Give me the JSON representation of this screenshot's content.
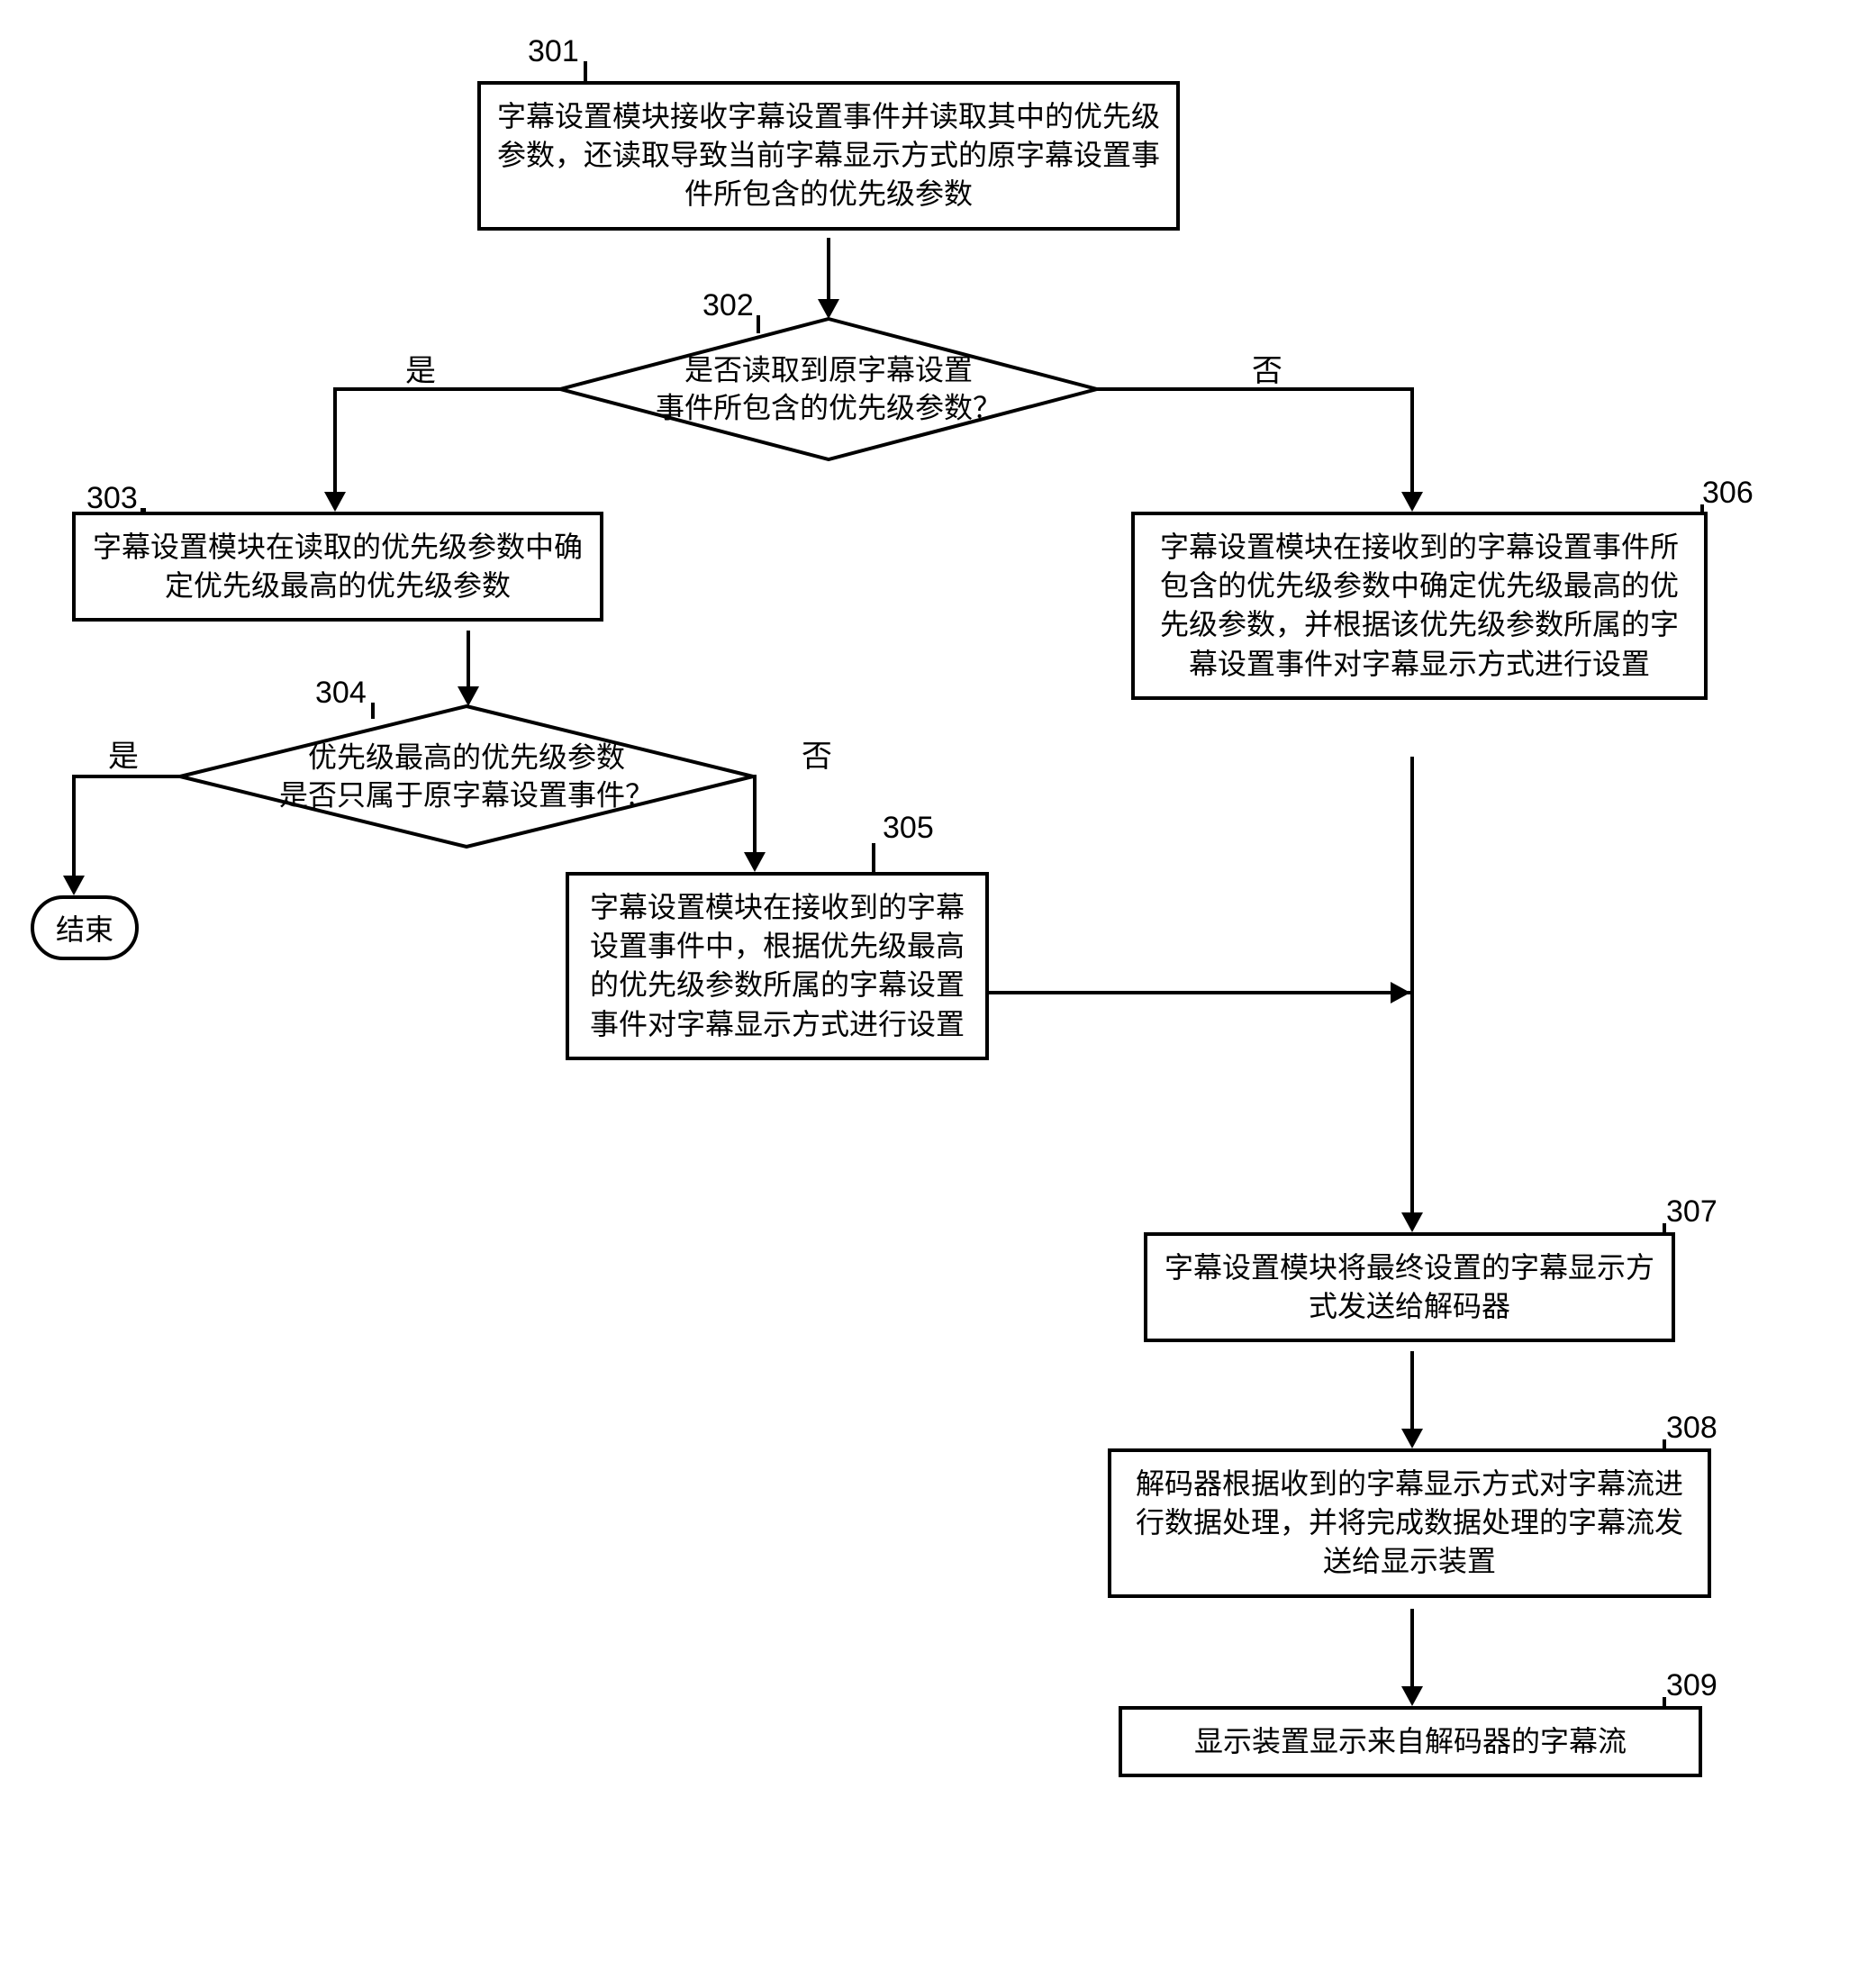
{
  "steps": {
    "s301": {
      "num": "301",
      "text": "字幕设置模块接收字幕设置事件并读取其中的优先级参数，还读取导致当前字幕显示方式的原字幕设置事件所包含的优先级参数"
    },
    "s302": {
      "num": "302",
      "text": "是否读取到原字幕设置事件所包含的优先级参数？"
    },
    "s303": {
      "num": "303",
      "text": "字幕设置模块在读取的优先级参数中确定优先级最高的优先级参数"
    },
    "s304": {
      "num": "304",
      "text": "优先级最高的优先级参数是否只属于原字幕设置事件？"
    },
    "s305": {
      "num": "305",
      "text": "字幕设置模块在接收到的字幕设置事件中，根据优先级最高的优先级参数所属的字幕设置事件对字幕显示方式进行设置"
    },
    "s306": {
      "num": "306",
      "text": "字幕设置模块在接收到的字幕设置事件所包含的优先级参数中确定优先级最高的优先级参数，并根据该优先级参数所属的字幕设置事件对字幕显示方式进行设置"
    },
    "s307": {
      "num": "307",
      "text": "字幕设置模块将最终设置的字幕显示方式发送给解码器"
    },
    "s308": {
      "num": "308",
      "text": "解码器根据收到的字幕显示方式对字幕流进行数据处理，并将完成数据处理的字幕流发送给显示装置"
    },
    "s309": {
      "num": "309",
      "text": "显示装置显示来自解码器的字幕流"
    },
    "end": {
      "text": "结束"
    }
  },
  "labels": {
    "yes": "是",
    "no": "否"
  }
}
